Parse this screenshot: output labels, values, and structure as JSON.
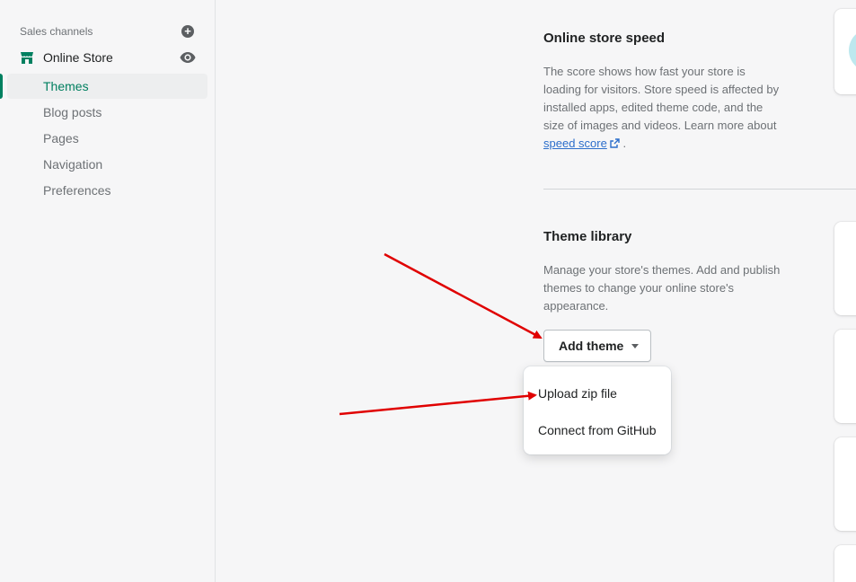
{
  "sidebar": {
    "section_label": "Sales channels",
    "add_icon": "plus-circle-icon",
    "store": {
      "label": "Online Store",
      "icon": "store-icon",
      "view_icon": "eye-icon"
    },
    "items": [
      {
        "label": "Themes",
        "active": true
      },
      {
        "label": "Blog posts",
        "active": false
      },
      {
        "label": "Pages",
        "active": false
      },
      {
        "label": "Navigation",
        "active": false
      },
      {
        "label": "Preferences",
        "active": false
      }
    ]
  },
  "speed": {
    "title": "Online store speed",
    "desc_line1": "The score shows how fast your store is",
    "desc_line2": "loading for visitors. Store speed is affected by",
    "desc_line3": "installed apps, edited theme code, and the",
    "desc_line4": "size of images and videos. Learn more about",
    "link": "speed score",
    "link_suffix": "."
  },
  "library": {
    "title": "Theme library",
    "desc_line1": "Manage your store's themes. Add and publish",
    "desc_line2": "themes to change your online store's",
    "desc_line3": "appearance.",
    "add_button": "Add theme",
    "dropdown": [
      "Upload zip file",
      "Connect from GitHub"
    ]
  },
  "colors": {
    "accent_green": "#008060",
    "link_blue": "#2c6ecb",
    "annotation_red": "#e00000"
  }
}
